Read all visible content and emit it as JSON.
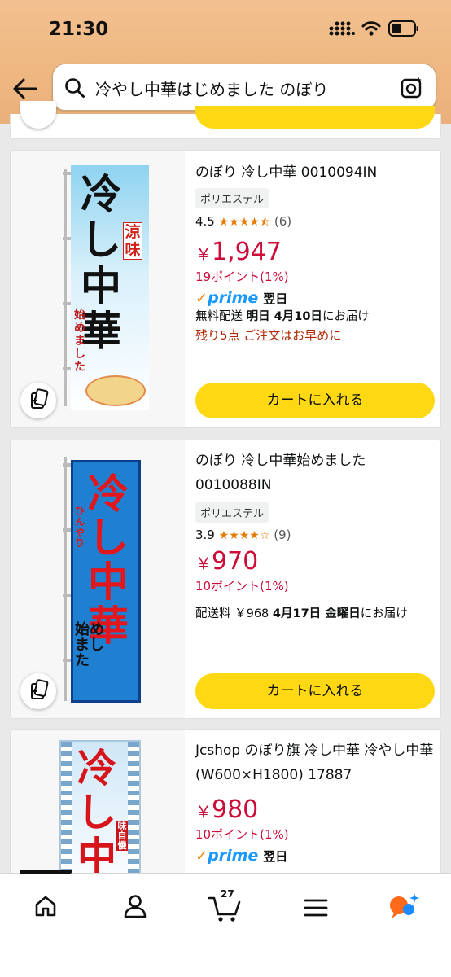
{
  "status_bar": {
    "time": "21:30"
  },
  "search": {
    "query": "冷やし中華はじめました のぼり"
  },
  "products": [
    {
      "title": "のぼり 冷し中華 0010094IN",
      "material": "ポリエステル",
      "rating": "4.5",
      "stars": "★★★★⯪",
      "review_count": "(6)",
      "price_symbol": "￥",
      "price": "1,947",
      "points": "19ポイント(1%)",
      "prime_label": "prime",
      "prime_delivery": "翌日",
      "delivery_prefix": "無料配送 ",
      "delivery_bold": "明日 4月10日",
      "delivery_suffix": "にお届け",
      "stock_note": "残り5点 ご注文はお早めに",
      "cart_label": "カートに入れる",
      "banner": {
        "main": "冷し中華",
        "sub": "始めました",
        "badge": "涼味"
      }
    },
    {
      "title": "のぼり 冷し中華始めました 0010088IN",
      "material": "ポリエステル",
      "rating": "3.9",
      "stars": "★★★★☆",
      "review_count": "(9)",
      "price_symbol": "￥",
      "price": "970",
      "points": "10ポイント(1%)",
      "delivery_prefix": "配送料 ￥968 ",
      "delivery_bold": "4月17日 金曜日",
      "delivery_suffix": "にお届け",
      "cart_label": "カートに入れる",
      "banner": {
        "main": "冷し中華",
        "sub": "始めました",
        "badge": "ひんやり"
      }
    },
    {
      "title": "Jcshop のぼり旗 冷し中華 冷やし中華 (W600×H1800) 17887",
      "price_symbol": "￥",
      "price": "980",
      "points": "10ポイント(1%)",
      "prime_label": "prime",
      "prime_delivery": "翌日",
      "banner": {
        "main": "冷し中",
        "badge": "味自慢"
      }
    }
  ],
  "bottom_nav": {
    "cart_count": "27"
  },
  "colors": {
    "accent_yellow": "#ffd814",
    "price_red": "#cc0c39",
    "prime_blue": "#1a98ff",
    "header": "#efb882"
  }
}
